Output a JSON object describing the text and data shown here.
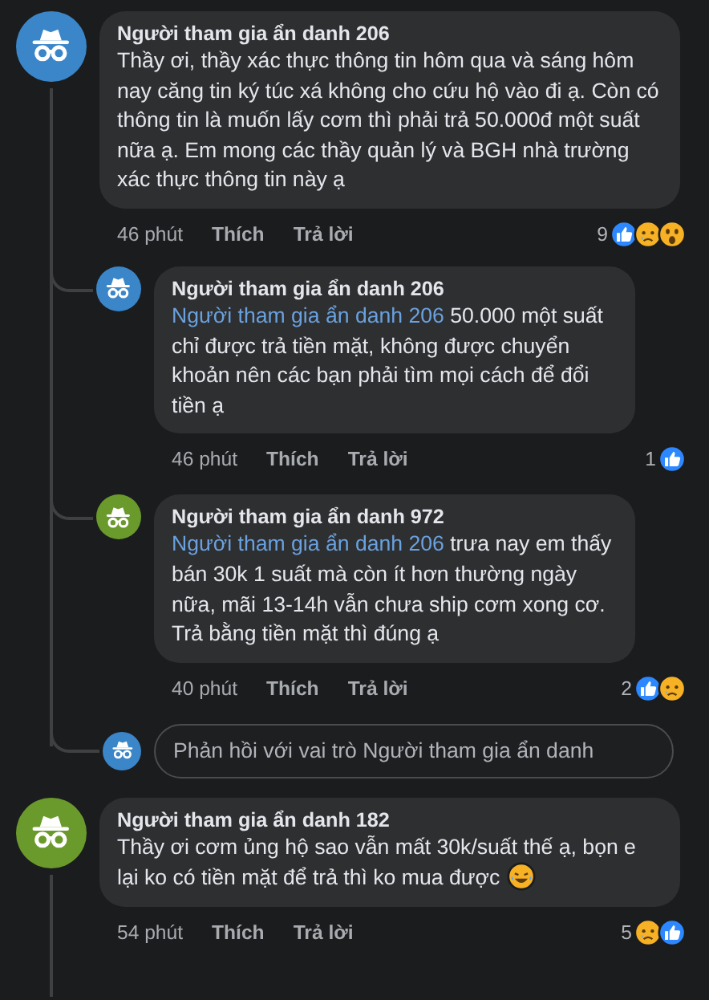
{
  "comments": [
    {
      "author": "Người tham gia ẩn danh 206",
      "color": "#3a86c8",
      "text": "Thầy ơi, thầy xác thực thông tin hôm qua và sáng hôm nay căng tin ký túc xá không cho cứu hộ vào đi ạ. Còn có thông tin là muốn lấy cơm thì phải trả 50.000đ một suất nữa ạ. Em mong các thầy quản lý và BGH nhà trường xác thực thông tin này ạ",
      "time": "46 phút",
      "like": "Thích",
      "reply": "Trả lời",
      "reaction_count": "9",
      "reactions": [
        {
          "kind": "like"
        },
        {
          "kind": "sad"
        },
        {
          "kind": "wow"
        }
      ],
      "replies": [
        {
          "author": "Người tham gia ẩn danh 206",
          "color": "#3a86c8",
          "mention": "Người tham gia ẩn danh 206",
          "text": "50.000 một suất chỉ được trả tiền mặt, không được chuyển khoản nên các bạn phải tìm mọi cách để đổi tiền ạ",
          "time": "46 phút",
          "like": "Thích",
          "reply": "Trả lời",
          "reaction_count": "1",
          "reactions": [
            {
              "kind": "like"
            }
          ]
        },
        {
          "author": "Người tham gia ẩn danh 972",
          "color": "#6b9a2c",
          "mention": "Người tham gia ẩn danh 206",
          "text": "trưa nay em thấy bán 30k 1 suất mà còn ít hơn thường ngày nữa, mãi 13-14h vẫn chưa ship cơm xong cơ. Trả bằng tiền mặt thì đúng ạ",
          "time": "40 phút",
          "like": "Thích",
          "reply": "Trả lời",
          "reaction_count": "2",
          "reactions": [
            {
              "kind": "like"
            },
            {
              "kind": "sad"
            }
          ]
        }
      ],
      "reply_box": {
        "color": "#3a86c8",
        "placeholder": "Phản hồi với vai trò Người tham gia ẩn danh"
      }
    },
    {
      "author": "Người tham gia ẩn danh 182",
      "color": "#6b9a2c",
      "text": "Thầy ơi cơm ủng hộ sao vẫn mất 30k/suất thế ạ, bọn e lại ko có tiền mặt để trả thì ko mua được",
      "emoji": {
        "kind": "laugh"
      },
      "time": "54 phút",
      "like": "Thích",
      "reply": "Trả lời",
      "reaction_count": "5",
      "reactions": [
        {
          "kind": "sad"
        },
        {
          "kind": "like"
        }
      ]
    }
  ]
}
